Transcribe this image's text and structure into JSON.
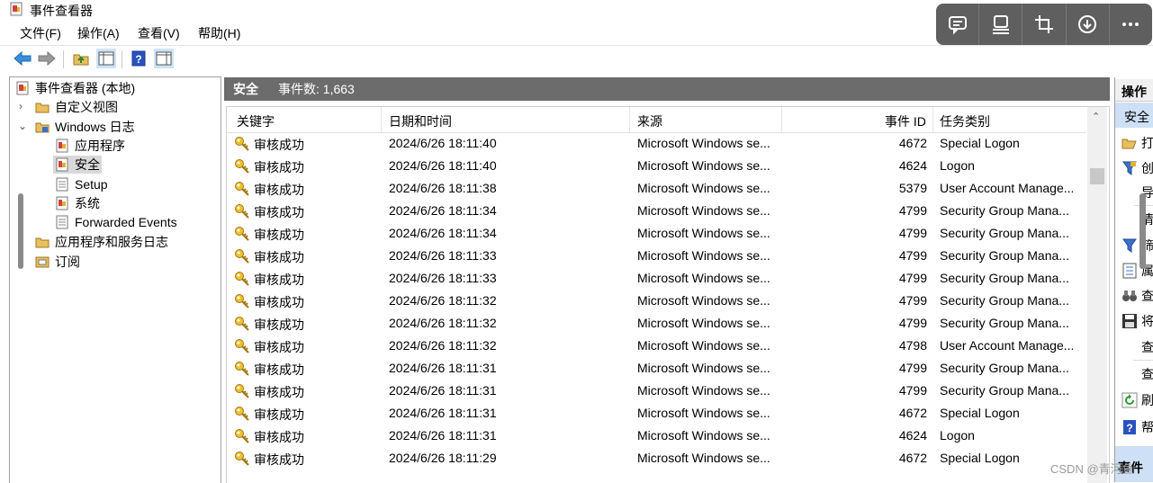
{
  "window": {
    "title": "事件查看器"
  },
  "menu": [
    "文件(F)",
    "操作(A)",
    "查看(V)",
    "帮助(H)"
  ],
  "toolbar_icons": [
    "back-arrow-icon",
    "forward-arrow-icon",
    "up-folder-icon",
    "show-hide-tree-icon",
    "help-icon",
    "console-view-icon"
  ],
  "overlay_icons": [
    "comment-icon",
    "notes-icon",
    "crop-icon",
    "download-icon",
    "more-icon"
  ],
  "tree": {
    "root": "事件查看器 (本地)",
    "custom_views": "自定义视图",
    "windows_logs": "Windows 日志",
    "application": "应用程序",
    "security": "安全",
    "setup": "Setup",
    "system": "系统",
    "forwarded": "Forwarded Events",
    "app_service_logs": "应用程序和服务日志",
    "subscriptions": "订阅"
  },
  "center": {
    "title": "安全",
    "count_label": "事件数: 1,663"
  },
  "columns": {
    "keyword": "关键字",
    "datetime": "日期和时间",
    "source": "来源",
    "event_id": "事件 ID",
    "task": "任务类别"
  },
  "rows": [
    {
      "keyword": "审核成功",
      "datetime": "2024/6/26 18:11:40",
      "source": "Microsoft Windows se...",
      "event_id": "4672",
      "task": "Special Logon"
    },
    {
      "keyword": "审核成功",
      "datetime": "2024/6/26 18:11:40",
      "source": "Microsoft Windows se...",
      "event_id": "4624",
      "task": "Logon"
    },
    {
      "keyword": "审核成功",
      "datetime": "2024/6/26 18:11:38",
      "source": "Microsoft Windows se...",
      "event_id": "5379",
      "task": "User Account Manage..."
    },
    {
      "keyword": "审核成功",
      "datetime": "2024/6/26 18:11:34",
      "source": "Microsoft Windows se...",
      "event_id": "4799",
      "task": "Security Group Mana..."
    },
    {
      "keyword": "审核成功",
      "datetime": "2024/6/26 18:11:34",
      "source": "Microsoft Windows se...",
      "event_id": "4799",
      "task": "Security Group Mana..."
    },
    {
      "keyword": "审核成功",
      "datetime": "2024/6/26 18:11:33",
      "source": "Microsoft Windows se...",
      "event_id": "4799",
      "task": "Security Group Mana..."
    },
    {
      "keyword": "审核成功",
      "datetime": "2024/6/26 18:11:33",
      "source": "Microsoft Windows se...",
      "event_id": "4799",
      "task": "Security Group Mana..."
    },
    {
      "keyword": "审核成功",
      "datetime": "2024/6/26 18:11:32",
      "source": "Microsoft Windows se...",
      "event_id": "4799",
      "task": "Security Group Mana..."
    },
    {
      "keyword": "审核成功",
      "datetime": "2024/6/26 18:11:32",
      "source": "Microsoft Windows se...",
      "event_id": "4799",
      "task": "Security Group Mana..."
    },
    {
      "keyword": "审核成功",
      "datetime": "2024/6/26 18:11:32",
      "source": "Microsoft Windows se...",
      "event_id": "4798",
      "task": "User Account Manage..."
    },
    {
      "keyword": "审核成功",
      "datetime": "2024/6/26 18:11:31",
      "source": "Microsoft Windows se...",
      "event_id": "4799",
      "task": "Security Group Mana..."
    },
    {
      "keyword": "审核成功",
      "datetime": "2024/6/26 18:11:31",
      "source": "Microsoft Windows se...",
      "event_id": "4799",
      "task": "Security Group Mana..."
    },
    {
      "keyword": "审核成功",
      "datetime": "2024/6/26 18:11:31",
      "source": "Microsoft Windows se...",
      "event_id": "4672",
      "task": "Special Logon"
    },
    {
      "keyword": "审核成功",
      "datetime": "2024/6/26 18:11:31",
      "source": "Microsoft Windows se...",
      "event_id": "4624",
      "task": "Logon"
    },
    {
      "keyword": "审核成功",
      "datetime": "2024/6/26 18:11:29",
      "source": "Microsoft Windows se...",
      "event_id": "4672",
      "task": "Special Logon"
    }
  ],
  "actions": {
    "header": "操作",
    "subheader": "安全",
    "fragments": [
      "打",
      "创",
      "导",
      "清",
      "筛",
      "属",
      "查",
      "将",
      "查",
      "查",
      "刷",
      "帮"
    ],
    "bottom": "事件"
  },
  "watermark": "CSDN @青河鱼"
}
